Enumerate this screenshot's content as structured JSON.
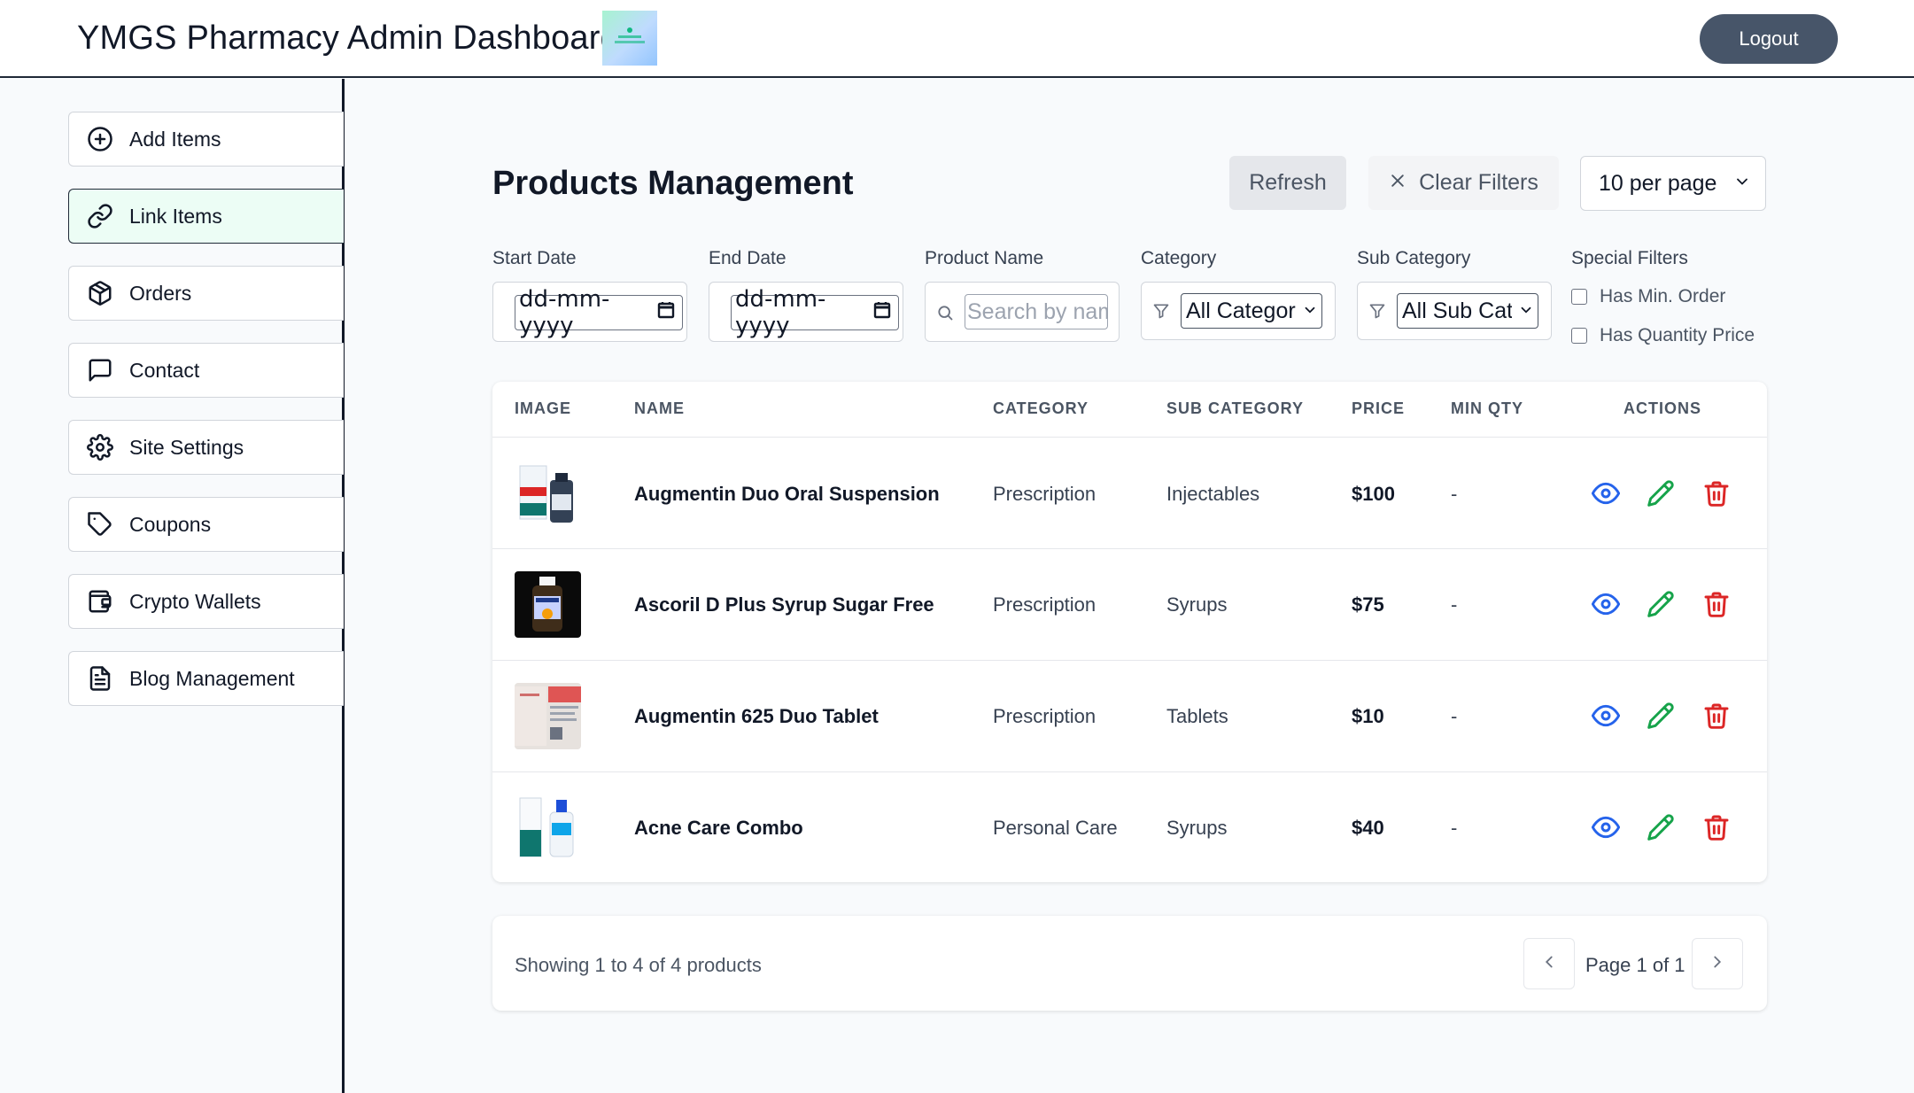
{
  "header": {
    "title": "YMGS Pharmacy Admin Dashboard",
    "logout_label": "Logout"
  },
  "sidebar": {
    "items": [
      {
        "label": "Add Items",
        "icon": "plus-circle-icon"
      },
      {
        "label": "Link Items",
        "icon": "link-icon",
        "active": true
      },
      {
        "label": "Orders",
        "icon": "package-icon"
      },
      {
        "label": "Contact",
        "icon": "message-square-icon"
      },
      {
        "label": "Site Settings",
        "icon": "gear-icon"
      },
      {
        "label": "Coupons",
        "icon": "tag-icon"
      },
      {
        "label": "Crypto Wallets",
        "icon": "wallet-icon"
      },
      {
        "label": "Blog Management",
        "icon": "file-text-icon"
      }
    ]
  },
  "main": {
    "title": "Products Management",
    "refresh_label": "Refresh",
    "clear_filters_label": "Clear Filters",
    "per_page_value": "10 per page"
  },
  "filters": {
    "start_date_label": "Start Date",
    "start_date_placeholder": "dd-mm-yyyy",
    "end_date_label": "End Date",
    "end_date_placeholder": "dd-mm-yyyy",
    "product_name_label": "Product Name",
    "product_name_placeholder": "Search by nam",
    "category_label": "Category",
    "category_value": "All Categor",
    "sub_category_label": "Sub Category",
    "sub_category_value": "All Sub Cat",
    "special_filters_label": "Special Filters",
    "has_min_order_label": "Has Min. Order",
    "has_quantity_price_label": "Has Quantity Price"
  },
  "table": {
    "columns": [
      "IMAGE",
      "NAME",
      "CATEGORY",
      "SUB CATEGORY",
      "PRICE",
      "MIN QTY",
      "ACTIONS"
    ],
    "rows": [
      {
        "name": "Augmentin Duo Oral Suspension",
        "category": "Prescription",
        "sub_category": "Injectables",
        "price": "$100",
        "min_qty": "-"
      },
      {
        "name": "Ascoril D Plus Syrup Sugar Free",
        "category": "Prescription",
        "sub_category": "Syrups",
        "price": "$75",
        "min_qty": "-"
      },
      {
        "name": "Augmentin 625 Duo Tablet",
        "category": "Prescription",
        "sub_category": "Tablets",
        "price": "$10",
        "min_qty": "-"
      },
      {
        "name": "Acne Care Combo",
        "category": "Personal Care",
        "sub_category": "Syrups",
        "price": "$40",
        "min_qty": "-"
      }
    ]
  },
  "pagination": {
    "showing_text": "Showing 1 to 4 of 4 products",
    "page_text": "Page 1 of 1"
  },
  "colors": {
    "view": "#2563eb",
    "edit": "#16a34a",
    "delete": "#dc2626",
    "logout_bg": "#475569"
  }
}
